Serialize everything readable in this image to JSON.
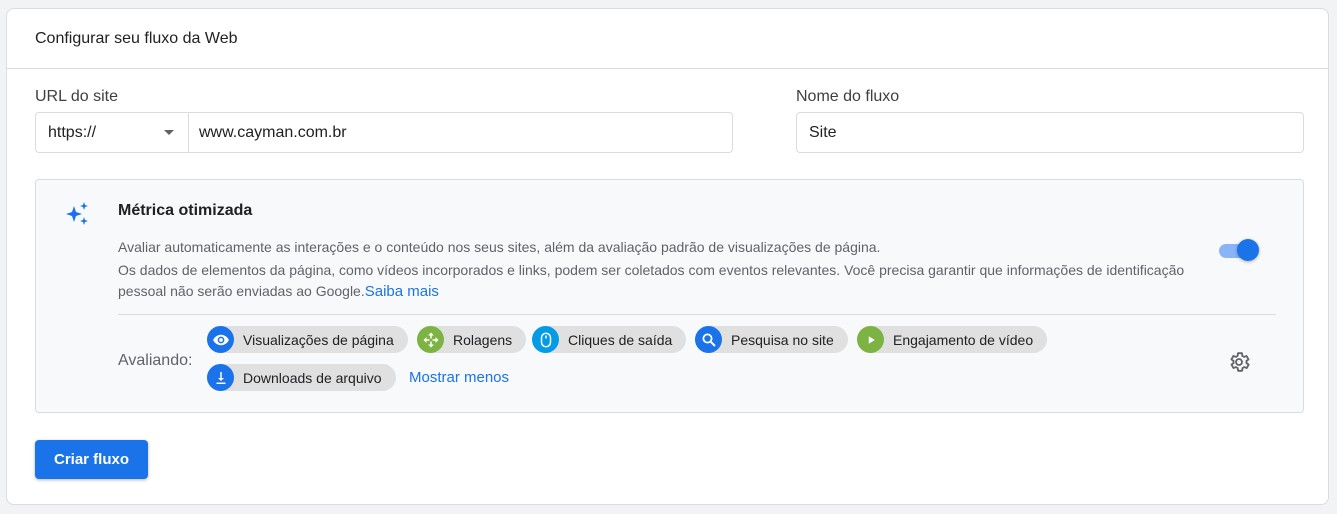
{
  "header": {
    "title": "Configurar seu fluxo da Web"
  },
  "url_section": {
    "label": "URL do site",
    "protocol": "https://",
    "url_value": "www.cayman.com.br"
  },
  "name_section": {
    "label": "Nome do fluxo",
    "value": "Site"
  },
  "enhanced_measurement": {
    "title": "Métrica otimizada",
    "description_line1": "Avaliar automaticamente as interações e o conteúdo nos seus sites, além da avaliação padrão de visualizações de página.",
    "description_line2": "Os dados de elementos da página, como vídeos incorporados e links, podem ser coletados com eventos relevantes. Você precisa garantir que informações de identificação pessoal não serão enviadas ao Google.",
    "learn_more": "Saiba mais",
    "toggle_on": true,
    "evaluating_label": "Avaliando:",
    "chips": [
      {
        "label": "Visualizações de página",
        "icon": "eye-icon",
        "color": "#1a73e8"
      },
      {
        "label": "Rolagens",
        "icon": "scroll-icon",
        "color": "#7cb342"
      },
      {
        "label": "Cliques de saída",
        "icon": "mouse-icon",
        "color": "#039be5"
      },
      {
        "label": "Pesquisa no site",
        "icon": "search-icon",
        "color": "#1a73e8"
      },
      {
        "label": "Engajamento de vídeo",
        "icon": "play-icon",
        "color": "#7cb342"
      },
      {
        "label": "Downloads de arquivo",
        "icon": "download-icon",
        "color": "#1a73e8"
      }
    ],
    "show_less": "Mostrar menos"
  },
  "actions": {
    "create_label": "Criar fluxo"
  },
  "colors": {
    "accent": "#1a73e8",
    "toggle_track": "#8ab4f8"
  }
}
